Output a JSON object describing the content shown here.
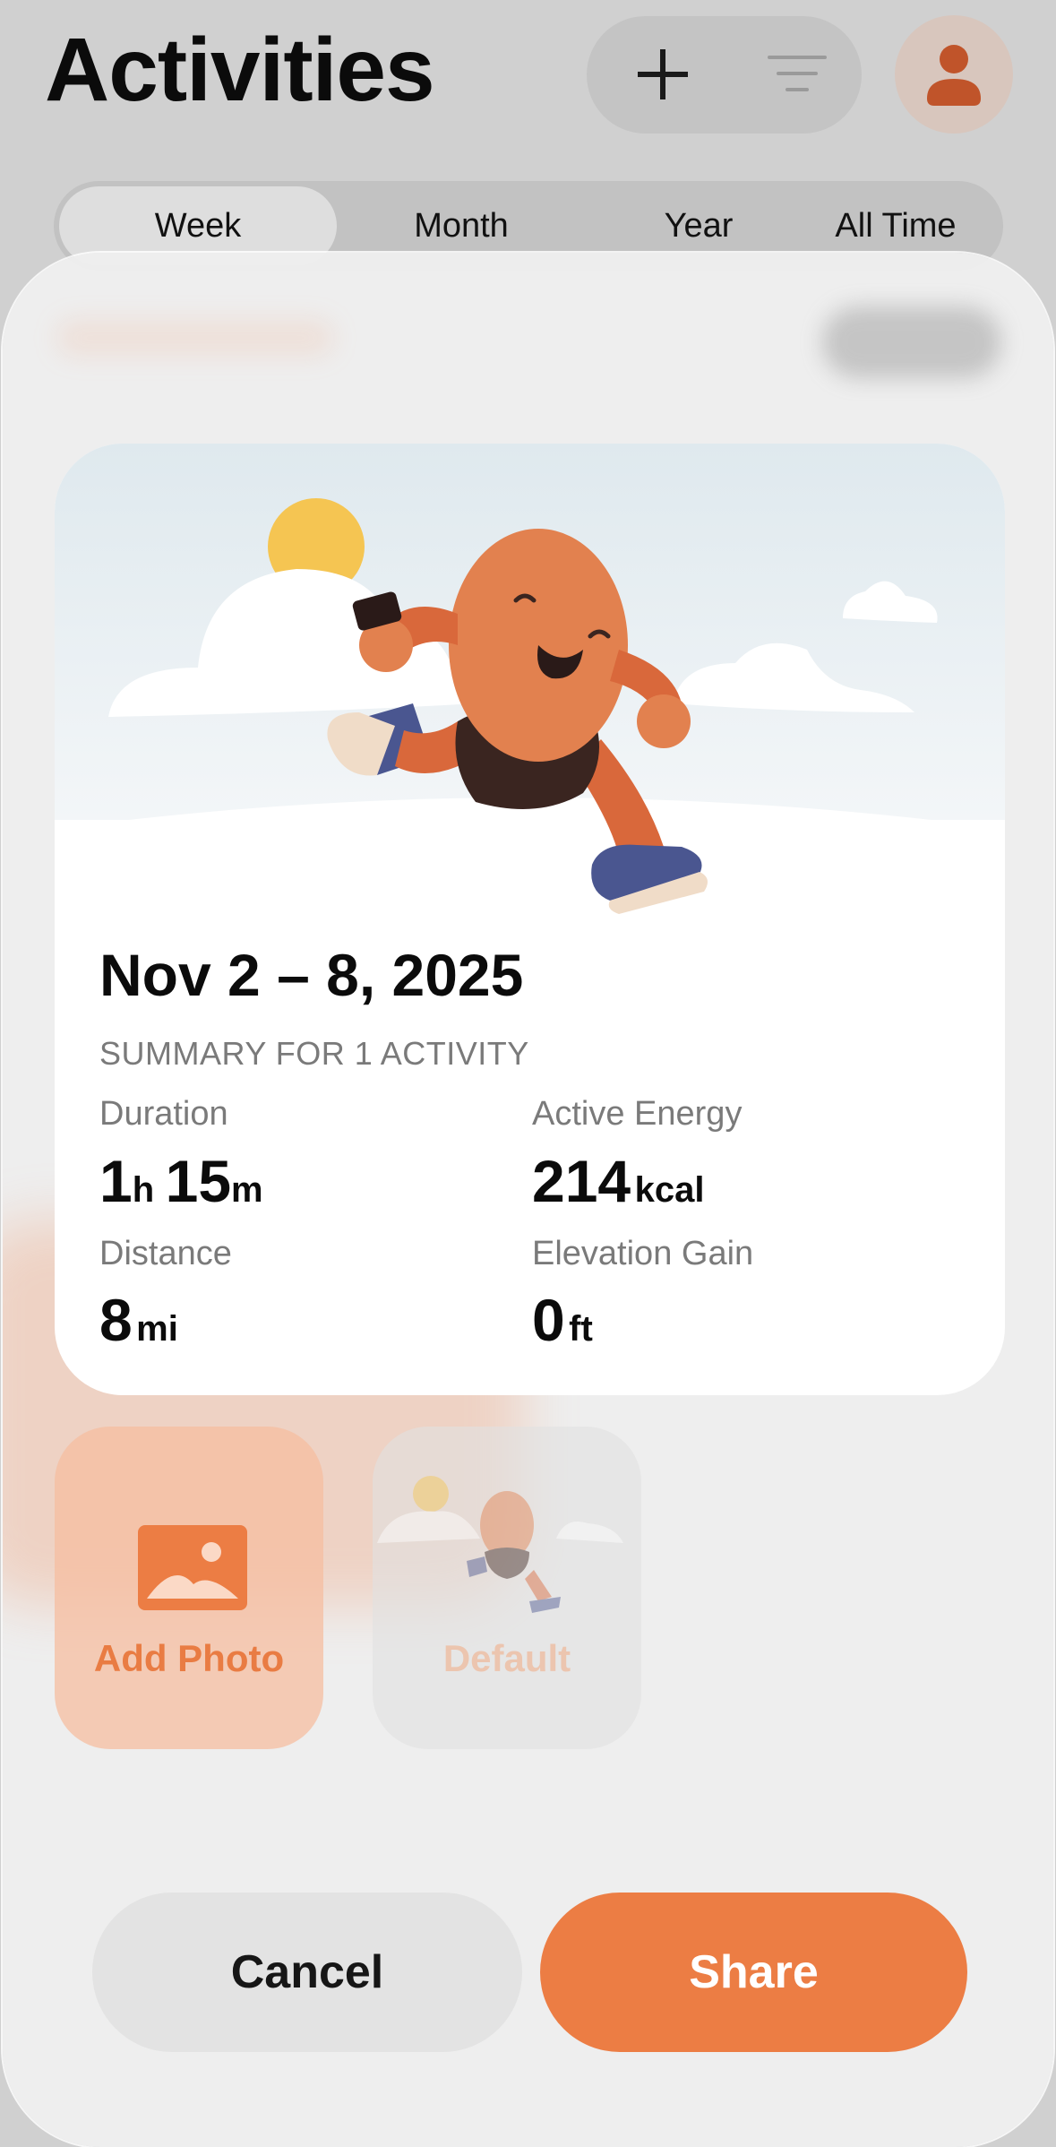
{
  "header": {
    "title": "Activities",
    "add_icon": "plus-icon",
    "filter_icon": "filter-lines-icon",
    "profile_icon": "person-icon"
  },
  "tabs": [
    {
      "label": "Week",
      "active": true
    },
    {
      "label": "Month",
      "active": false
    },
    {
      "label": "Year",
      "active": false
    },
    {
      "label": "All Time",
      "active": false
    }
  ],
  "share_card": {
    "date_range": "Nov 2 – 8, 2025",
    "subtitle": "SUMMARY FOR 1 ACTIVITY",
    "stats": {
      "duration": {
        "label": "Duration",
        "hours": "1",
        "hours_unit": "h",
        "minutes": "15",
        "minutes_unit": "m"
      },
      "active_energy": {
        "label": "Active Energy",
        "value": "214",
        "unit": "kcal"
      },
      "distance": {
        "label": "Distance",
        "value": "8",
        "unit": "mi"
      },
      "elevation_gain": {
        "label": "Elevation Gain",
        "value": "0",
        "unit": "ft"
      }
    }
  },
  "photo_options": {
    "add_photo": {
      "label": "Add Photo",
      "icon": "image-icon"
    },
    "default": {
      "label": "Default"
    }
  },
  "actions": {
    "cancel_label": "Cancel",
    "share_label": "Share"
  },
  "colors": {
    "accent": "#ec7d44",
    "text_primary": "#0b0b0b",
    "text_secondary": "#7a7a7a"
  }
}
